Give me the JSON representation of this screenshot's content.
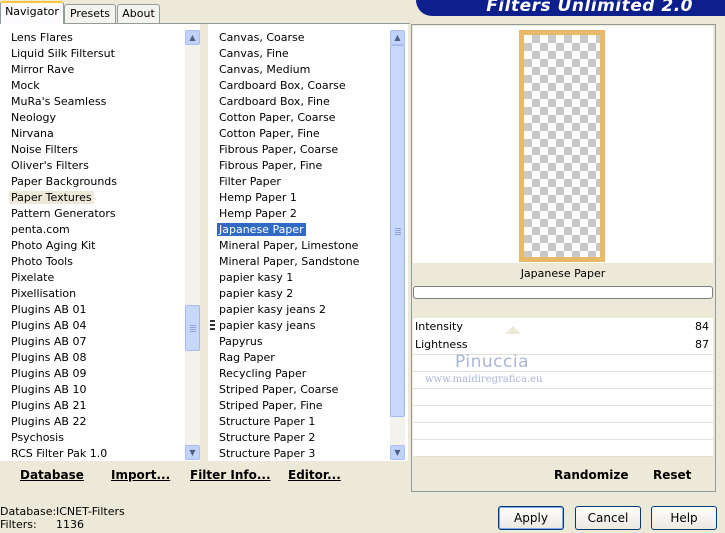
{
  "tabs": [
    {
      "label": "Navigator",
      "active": true
    },
    {
      "label": "Presets",
      "active": false
    },
    {
      "label": "About",
      "active": false
    }
  ],
  "banner_title": "Filters Unlimited 2.0",
  "categories": [
    {
      "label": "Lens Flares",
      "selected": false
    },
    {
      "label": "Liquid Silk Filtersut",
      "selected": false
    },
    {
      "label": "Mirror Rave",
      "selected": false
    },
    {
      "label": "Mock",
      "selected": false
    },
    {
      "label": "MuRa's Seamless",
      "selected": false
    },
    {
      "label": "Neology",
      "selected": false
    },
    {
      "label": "Nirvana",
      "selected": false
    },
    {
      "label": "Noise Filters",
      "selected": false
    },
    {
      "label": "Oliver's Filters",
      "selected": false
    },
    {
      "label": "Paper Backgrounds",
      "selected": false
    },
    {
      "label": "Paper Textures",
      "selected": true
    },
    {
      "label": "Pattern Generators",
      "selected": false
    },
    {
      "label": "penta.com",
      "selected": false
    },
    {
      "label": "Photo Aging Kit",
      "selected": false
    },
    {
      "label": "Photo Tools",
      "selected": false
    },
    {
      "label": "Pixelate",
      "selected": false
    },
    {
      "label": "Pixellisation",
      "selected": false
    },
    {
      "label": "Plugins AB 01",
      "selected": false
    },
    {
      "label": "Plugins AB 04",
      "selected": false
    },
    {
      "label": "Plugins AB 07",
      "selected": false
    },
    {
      "label": "Plugins AB 08",
      "selected": false
    },
    {
      "label": "Plugins AB 09",
      "selected": false
    },
    {
      "label": "Plugins AB 10",
      "selected": false
    },
    {
      "label": "Plugins AB 21",
      "selected": false
    },
    {
      "label": "Plugins AB 22",
      "selected": false
    },
    {
      "label": "Psychosis",
      "selected": false
    },
    {
      "label": "RCS Filter Pak 1.0",
      "selected": false
    }
  ],
  "filters": [
    {
      "label": "Canvas, Coarse",
      "selected": false
    },
    {
      "label": "Canvas, Fine",
      "selected": false
    },
    {
      "label": "Canvas, Medium",
      "selected": false
    },
    {
      "label": "Cardboard Box, Coarse",
      "selected": false
    },
    {
      "label": "Cardboard Box, Fine",
      "selected": false
    },
    {
      "label": "Cotton Paper, Coarse",
      "selected": false
    },
    {
      "label": "Cotton Paper, Fine",
      "selected": false
    },
    {
      "label": "Fibrous Paper, Coarse",
      "selected": false
    },
    {
      "label": "Fibrous Paper, Fine",
      "selected": false
    },
    {
      "label": "Filter Paper",
      "selected": false
    },
    {
      "label": "Hemp Paper 1",
      "selected": false
    },
    {
      "label": "Hemp Paper 2",
      "selected": false
    },
    {
      "label": "Japanese Paper",
      "selected": true
    },
    {
      "label": "Mineral Paper, Limestone",
      "selected": false
    },
    {
      "label": "Mineral Paper, Sandstone",
      "selected": false
    },
    {
      "label": "papier kasy 1",
      "selected": false
    },
    {
      "label": "papier kasy 2",
      "selected": false
    },
    {
      "label": "papier kasy jeans 2",
      "selected": false
    },
    {
      "label": "papier kasy jeans",
      "selected": false
    },
    {
      "label": "Papyrus",
      "selected": false
    },
    {
      "label": "Rag Paper",
      "selected": false
    },
    {
      "label": "Recycling Paper",
      "selected": false
    },
    {
      "label": "Striped Paper, Coarse",
      "selected": false
    },
    {
      "label": "Striped Paper, Fine",
      "selected": false
    },
    {
      "label": "Structure Paper 1",
      "selected": false
    },
    {
      "label": "Structure Paper 2",
      "selected": false
    },
    {
      "label": "Structure Paper 3",
      "selected": false
    }
  ],
  "bottom_links": {
    "database": "Database",
    "import": "Import...",
    "filter_info": "Filter Info...",
    "editor": "Editor...",
    "randomize": "Randomize",
    "reset": "Reset"
  },
  "preview": {
    "filter_name": "Japanese Paper",
    "progress": 0
  },
  "params": [
    {
      "label": "Intensity",
      "value": "84"
    },
    {
      "label": "Lightness",
      "value": "87"
    }
  ],
  "watermark": {
    "line1": "Pinuccia",
    "line2": "www.maidiregrafica.eu"
  },
  "status": {
    "database_label": "Database:",
    "database_value": "ICNET-Filters",
    "filters_label": "Filters:",
    "filters_value": "1136"
  },
  "buttons": {
    "apply": "Apply",
    "cancel": "Cancel",
    "help": "Help"
  },
  "colors": {
    "selection_blue": "#316ac5",
    "banner": "#0c1f8c",
    "preview_frame": "#e8b968"
  }
}
